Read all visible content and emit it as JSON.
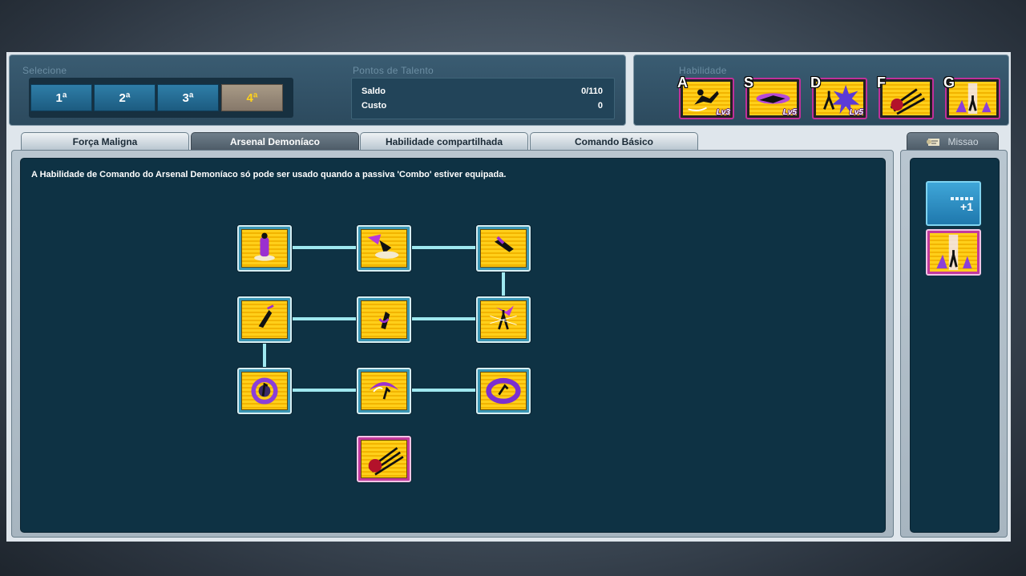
{
  "top": {
    "select_label": "Selecione",
    "select_buttons": [
      "1ª",
      "2ª",
      "3ª",
      "4ª"
    ],
    "active_selection": "4ª",
    "talent_label": "Pontos de Talento",
    "balance_label": "Saldo",
    "balance_value": "0/110",
    "cost_label": "Custo",
    "cost_value": "0",
    "skills_label": "Habilidade"
  },
  "hotkeys": [
    {
      "letter": "A",
      "level": "Lv3",
      "icon": "kick-skill-icon"
    },
    {
      "letter": "S",
      "level": "Lv5",
      "icon": "dash-skill-icon"
    },
    {
      "letter": "D",
      "level": "Lv5",
      "icon": "burst-skill-icon"
    },
    {
      "letter": "F",
      "level": "",
      "icon": "claw-skill-icon"
    },
    {
      "letter": "G",
      "level": "",
      "icon": "aura-skill-icon"
    }
  ],
  "tabs": [
    {
      "label": "Força Maligna",
      "active": false
    },
    {
      "label": "Arsenal Demoníaco",
      "active": true
    },
    {
      "label": "Habilidade compartilhada",
      "active": false
    },
    {
      "label": "Comando Básico",
      "active": false
    }
  ],
  "mission_tab": {
    "label": "Missao",
    "icon": "mission-scroll-icon"
  },
  "main": {
    "info": "A Habilidade de Comando do Arsenal Demoníaco só pode ser usado quando a passiva 'Combo' estiver equipada."
  },
  "side": {
    "plus_label": "+1",
    "skill_icon": "aura-skill-icon"
  },
  "tree_nodes": [
    {
      "icon": "purple-stance-icon"
    },
    {
      "icon": "purple-leap-icon"
    },
    {
      "icon": "dash-strike-icon"
    },
    {
      "icon": "uppercut-icon"
    },
    {
      "icon": "spin-attack-icon"
    },
    {
      "icon": "purple-burst-icon"
    },
    {
      "icon": "vortex-icon"
    },
    {
      "icon": "crescent-slash-icon"
    },
    {
      "icon": "purple-whirl-icon"
    },
    {
      "icon": "claw-skill-icon"
    }
  ],
  "colors": {
    "panel": "#2c4a5e",
    "tree_background": "#0e3244",
    "connector": "#9fe8f0",
    "active_select": "#ffd21a",
    "skill_gold": "#ffcf1a",
    "node_frame_pink": "#c23a9d"
  }
}
